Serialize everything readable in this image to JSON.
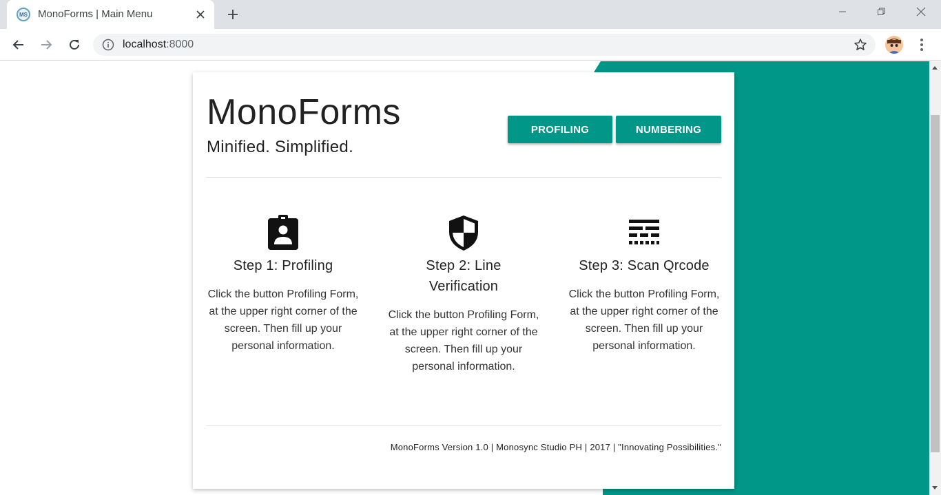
{
  "browser": {
    "tab_title": "MonoForms | Main Menu",
    "favicon_text": "MS",
    "url_host": "localhost",
    "url_port": ":8000"
  },
  "page": {
    "brand_title": "MonoForms",
    "tagline": "Minified. Simplified.",
    "buttons": {
      "profiling": "PROFILING",
      "numbering": "NUMBERING"
    },
    "steps": [
      {
        "icon": "assignment-ind-icon",
        "title": "Step 1: Profiling",
        "description": "Click the button Profiling Form, at the upper right corner of the screen. Then fill up your personal information."
      },
      {
        "icon": "shield-icon",
        "title": "Step 2: Line Verification",
        "description": "Click the button Profiling Form, at the upper right corner of the screen. Then fill up your personal information."
      },
      {
        "icon": "line-style-icon",
        "title": "Step 3: Scan Qrcode",
        "description": "Click the button Profiling Form, at the upper right corner of the screen. Then fill up your personal information."
      }
    ],
    "footer": "MonoForms Version 1.0 | Monosync Studio PH | 2017 | \"Innovating Possibilities.\""
  },
  "colors": {
    "accent": "#009688",
    "text": "#222222"
  }
}
